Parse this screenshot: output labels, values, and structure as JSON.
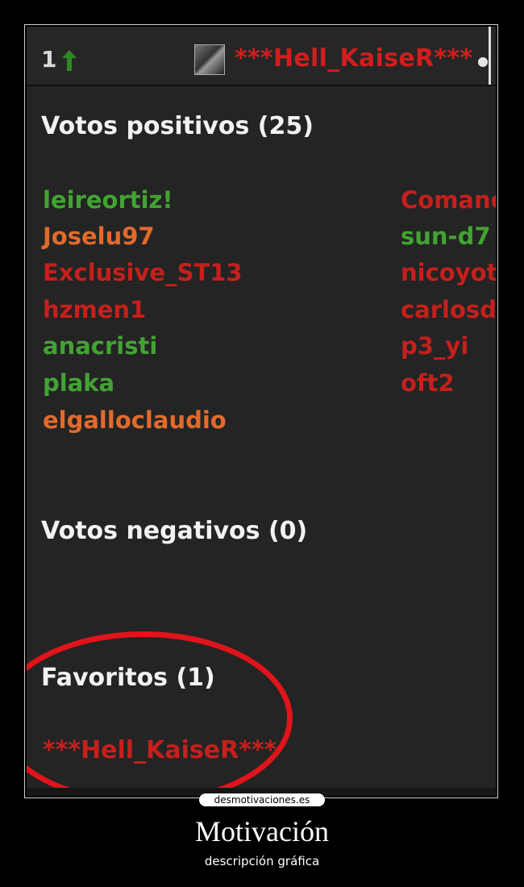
{
  "header": {
    "vote_count": "1",
    "user": "***Hell_KaiseR***"
  },
  "positive": {
    "title": "Votos positivos (25)",
    "left_column": [
      {
        "name": "leireortiz!",
        "color": "#42a332"
      },
      {
        "name": "Joselu97",
        "color": "#e26a2c"
      },
      {
        "name": "Exclusive_ST13",
        "color": "#c4201c"
      },
      {
        "name": "hzmen1",
        "color": "#c4201c"
      },
      {
        "name": "anacristi",
        "color": "#42a332"
      },
      {
        "name": "plaka",
        "color": "#42a332"
      },
      {
        "name": "elgalloclaudio",
        "color": "#e26a2c"
      }
    ],
    "right_column": [
      {
        "name": "Comand",
        "color": "#c4201c"
      },
      {
        "name": "sun-d7",
        "color": "#42a332"
      },
      {
        "name": "nicoyot",
        "color": "#c4201c"
      },
      {
        "name": "carlosde",
        "color": "#c4201c"
      },
      {
        "name": "p3_yi",
        "color": "#c4201c"
      },
      {
        "name": "oft2",
        "color": "#c4201c"
      }
    ]
  },
  "negative": {
    "title": "Votos negativos (0)"
  },
  "favorites": {
    "title": "Favoritos (1)",
    "user": "***Hell_KaiseR***"
  },
  "watermark": "desmotivaciones.es",
  "caption": {
    "title": "Motivación",
    "subtitle": "descripción gráfica"
  }
}
